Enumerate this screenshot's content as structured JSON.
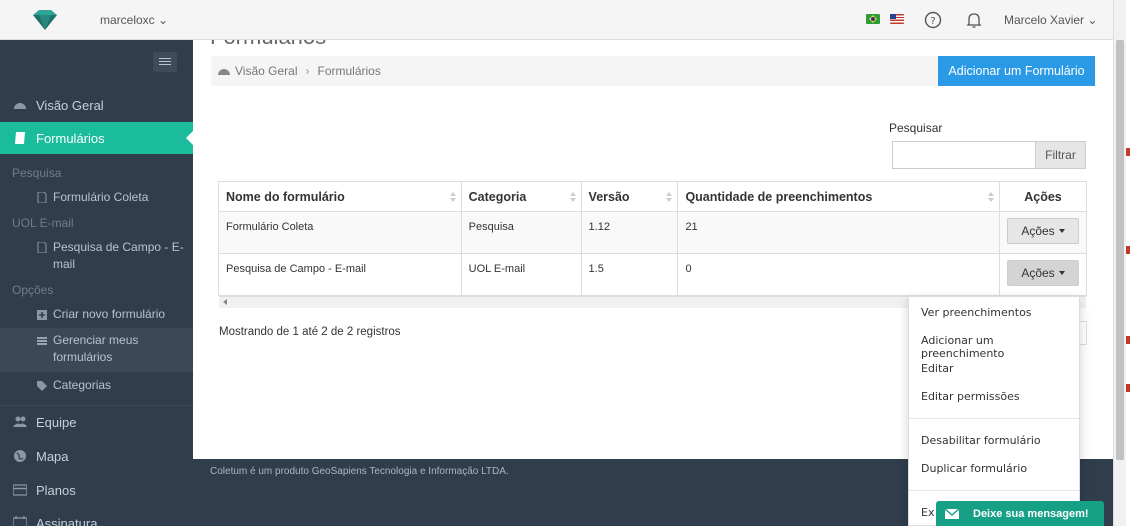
{
  "topbar": {
    "account": "marceloxc",
    "user_name": "Marcelo Xavier"
  },
  "page": {
    "title": "Formulários"
  },
  "sidebar": {
    "overview": "Visão Geral",
    "forms": "Formulários",
    "groups": [
      {
        "label": "Pesquisa",
        "items": [
          "Formulário Coleta"
        ]
      },
      {
        "label": "UOL E-mail",
        "items": [
          "Pesquisa de Campo - E-mail"
        ]
      },
      {
        "label": "Opções",
        "items": [
          "Criar novo formulário",
          "Gerenciar meus formulários",
          "Categorias"
        ]
      }
    ],
    "team": "Equipe",
    "map": "Mapa",
    "plans": "Planos",
    "subscription": "Assinatura"
  },
  "breadcrumb": {
    "home": "Visão Geral",
    "current": "Formulários"
  },
  "add_button": "Adicionar um Formulário",
  "search": {
    "label": "Pesquisar",
    "button": "Filtrar",
    "value": ""
  },
  "table": {
    "headers": [
      "Nome do formulário",
      "Categoria",
      "Versão",
      "Quantidade de preenchimentos",
      "Ações"
    ],
    "rows": [
      {
        "name": "Formulário Coleta",
        "category": "Pesquisa",
        "version": "1.12",
        "count": "21",
        "actions": "Ações"
      },
      {
        "name": "Pesquisa de Campo - E-mail",
        "category": "UOL E-mail",
        "version": "1.5",
        "count": "0",
        "actions": "Ações"
      }
    ],
    "info": "Mostrando de 1 até 2 de 2 registros"
  },
  "dropdown": {
    "items": [
      "Ver preenchimentos",
      "Adicionar um preenchimento",
      "Editar",
      "Editar permissões",
      "Desabilitar formulário",
      "Duplicar formulário",
      "Excluir formulário"
    ],
    "visible_last": "Ex"
  },
  "footer": {
    "text": "Coletum é um produto GeoSapiens Tecnologia e Informação LTDA."
  },
  "message_button": "Deixe sua mensagem!",
  "colors": {
    "accent": "#1abc9c",
    "primary": "#2b9ae6",
    "sidebar": "#2f3d4c"
  }
}
